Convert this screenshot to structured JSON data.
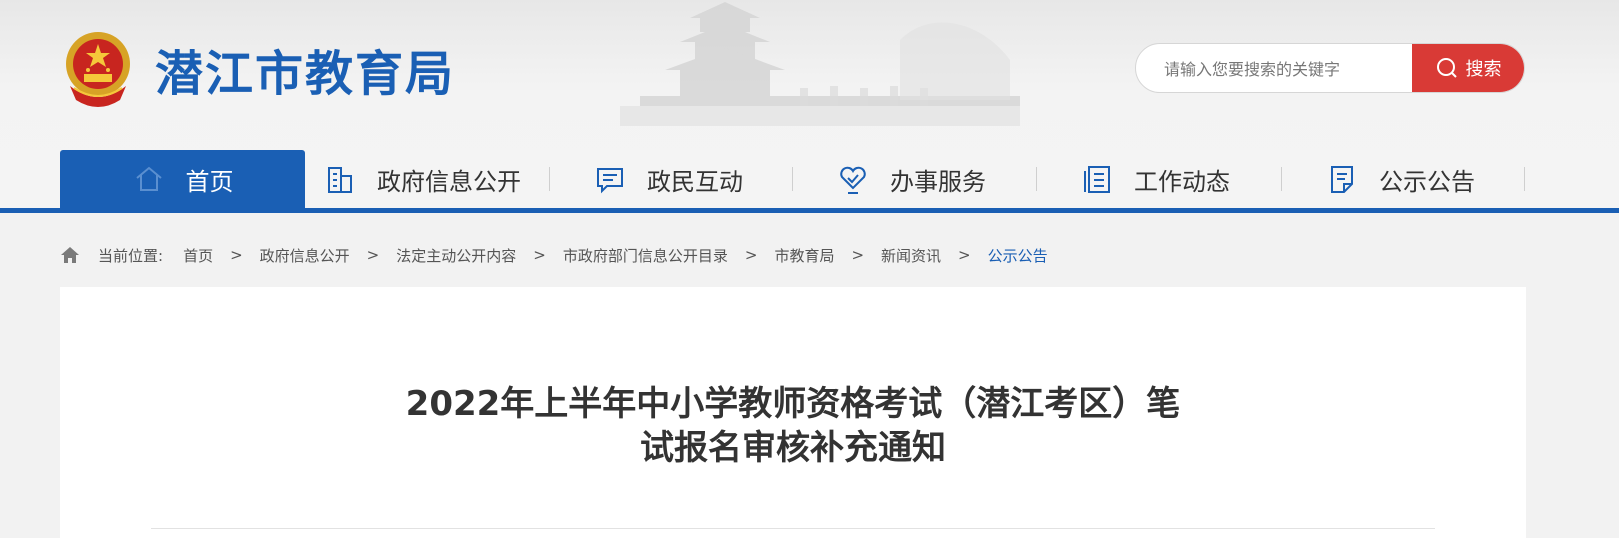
{
  "site": {
    "title": "潜江市教育局",
    "emblem_icon": "national-emblem-icon"
  },
  "search": {
    "placeholder": "请输入您要搜索的关键字",
    "button_label": "搜索",
    "accent_color": "#d93a36"
  },
  "nav": {
    "accent_color": "#1a5fb4",
    "items": [
      {
        "label": "首页",
        "icon": "home-icon",
        "active": true
      },
      {
        "label": "政府信息公开",
        "icon": "building-icon",
        "active": false
      },
      {
        "label": "政民互动",
        "icon": "chat-icon",
        "active": false
      },
      {
        "label": "办事服务",
        "icon": "heart-service-icon",
        "active": false
      },
      {
        "label": "工作动态",
        "icon": "document-list-icon",
        "active": false
      },
      {
        "label": "公示公告",
        "icon": "notice-icon",
        "active": false
      }
    ]
  },
  "breadcrumb": {
    "prefix": "当前位置:",
    "separator": ">",
    "items": [
      "首页",
      "政府信息公开",
      "法定主动公开内容",
      "市政府部门信息公开目录",
      "市教育局",
      "新闻资讯",
      "公示公告"
    ]
  },
  "article": {
    "title_line1": "2022年上半年中小学教师资格考试（潜江考区）笔",
    "title_line2": "试报名审核补充通知"
  }
}
